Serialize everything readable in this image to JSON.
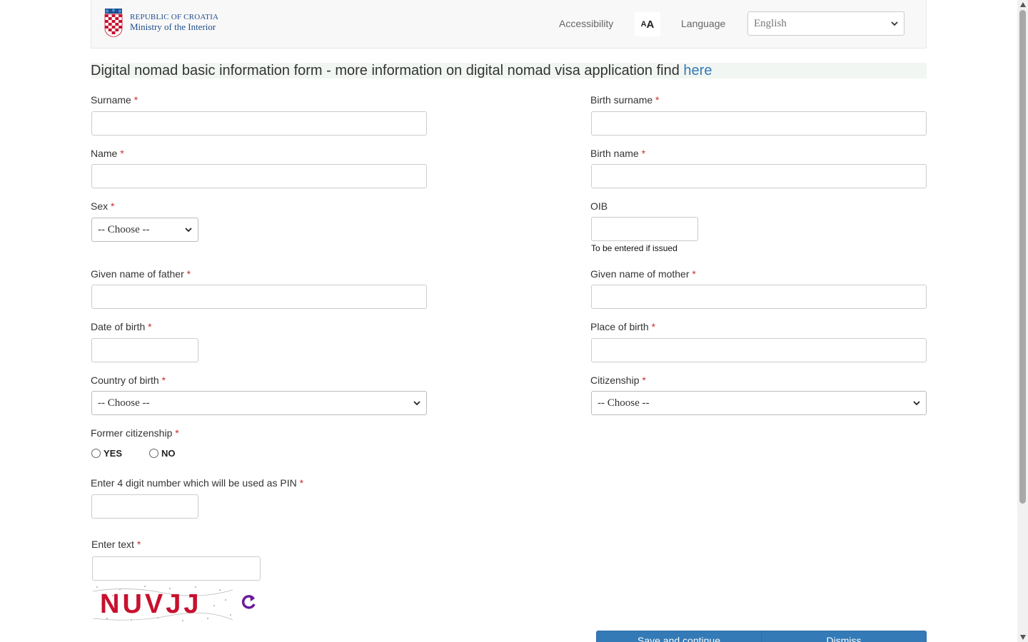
{
  "header": {
    "logo_line1": "REPUBLIC OF CROATIA",
    "logo_line2": "Ministry of the Interior",
    "accessibility": "Accessibility",
    "font_size_button": "AA",
    "language_label": "Language",
    "language_selected": "English"
  },
  "title": {
    "text": "Digital nomad basic information form - more information on digital nomad visa application find ",
    "link": "here"
  },
  "required_mark": "*",
  "fields": {
    "surname": "Surname",
    "birth_surname": "Birth surname",
    "name": "Name",
    "birth_name": "Birth name",
    "sex": "Sex",
    "sex_value": "-- Choose --",
    "oib": "OIB",
    "oib_help": "To be entered if issued",
    "father": "Given name of father",
    "mother": "Given name of mother",
    "dob": "Date of birth",
    "pob": "Place of birth",
    "country_of_birth": "Country of birth",
    "country_value": "-- Choose --",
    "citizenship": "Citizenship",
    "citizenship_value": "-- Choose --",
    "former_citizenship": "Former citizenship",
    "yes": "YES",
    "no": "NO",
    "pin": "Enter 4 digit number which will be used as PIN",
    "enter_text": "Enter text"
  },
  "captcha": {
    "text": "NUVJJ"
  },
  "buttons": {
    "save": "Save and continue",
    "dismiss": "Dismiss"
  },
  "colors": {
    "link": "#337ab7",
    "required": "#c9302c",
    "captcha": "#c8102e",
    "refresh": "#6a1b9a"
  }
}
